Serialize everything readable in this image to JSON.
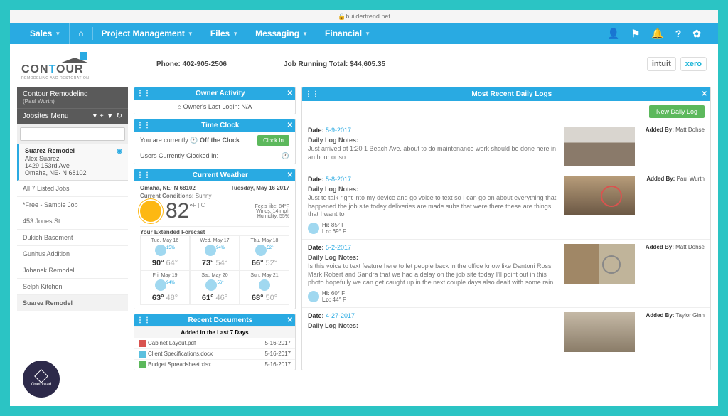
{
  "topbar": {
    "url": "buildertrend.net"
  },
  "menubar": {
    "items": [
      "Sales",
      "",
      "Project Management",
      "Files",
      "Messaging",
      "Financial"
    ],
    "icons": [
      "user-icon",
      "flag-icon",
      "bell-icon",
      "question-icon",
      "gear-icon"
    ]
  },
  "logo": {
    "brand": "CONTOUR",
    "sub": "REMODELING AND RESTORATION"
  },
  "header": {
    "phone_label": "Phone:",
    "phone": "402-905-2506",
    "total_label": "Job Running Total:",
    "total": "$44,605.35",
    "badge_intuit": "intuit",
    "badge_xero": "xero"
  },
  "sidebar": {
    "company": "Contour Remodeling",
    "company_sub": "(Paul Wurth)",
    "jobsites_label": "Jobsites Menu",
    "search_placeholder": "",
    "current": {
      "title": "Suarez Remodel",
      "sub1": "Alex Suarez",
      "sub2": "1429 153rd Ave",
      "sub3": "Omaha, NE· N 68102"
    },
    "filter": "All 7 Listed Jobs",
    "jobs": [
      "*Free - Sample Job",
      "453 Jones St",
      "Dukich Basement",
      "Gunhus Addition",
      "Johanek Remodel",
      "Selph Kitchen",
      "Suarez Remodel"
    ]
  },
  "panels": {
    "owner": {
      "title": "Owner Activity",
      "line": "Owner's Last Login: N/A"
    },
    "timeclock": {
      "title": "Time Clock",
      "status_pre": "You are currently",
      "status": "Off the Clock",
      "btn": "Clock In",
      "users_label": "Users Currently Clocked In:"
    },
    "weather": {
      "title": "Current Weather",
      "loc": "Omaha, NE· N 68102",
      "date": "Tuesday, May 16 2017",
      "cond_label": "Current Conditions:",
      "cond": "Sunny",
      "temp": "82",
      "feels_label": "Feels like:",
      "feels": "84°F",
      "wind_label": "Winds:",
      "wind": "14 mph",
      "hum_label": "Humidity:",
      "hum": "55%",
      "ext_title": "Your Extended Forecast",
      "forecast": [
        {
          "day": "Tue, May 16",
          "pct": "15%",
          "hi": "90°",
          "lo": "64°"
        },
        {
          "day": "Wed, May 17",
          "pct": "94%",
          "hi": "73°",
          "lo": "54°"
        },
        {
          "day": "Thu, May 18",
          "pct": "52°",
          "hi": "66°",
          "lo": "52°"
        },
        {
          "day": "Fri, May 19",
          "pct": "94%",
          "hi": "63°",
          "lo": "48°"
        },
        {
          "day": "Sat, May 20",
          "pct": "56°",
          "hi": "61°",
          "lo": "46°"
        },
        {
          "day": "Sun, May 21",
          "pct": "",
          "hi": "68°",
          "lo": "50°"
        }
      ]
    },
    "docs": {
      "title": "Recent Documents",
      "sub": "Added in the Last 7 Days",
      "items": [
        {
          "name": "Cabinet Layout.pdf",
          "date": "5-16-2017",
          "type": "pdf"
        },
        {
          "name": "Client Specifications.docx",
          "date": "5-16-2017",
          "type": "doc"
        },
        {
          "name": "Budget Spreadsheet.xlsx",
          "date": "5-16-2017",
          "type": "xls"
        }
      ]
    },
    "logs": {
      "title": "Most Recent Daily Logs",
      "new_btn": "New Daily Log",
      "date_label": "Date:",
      "notes_label": "Daily Log Notes:",
      "added_label": "Added By:",
      "hi_label": "Hi:",
      "lo_label": "Lo:",
      "items": [
        {
          "date": "5-9-2017",
          "notes": "Just arrived at 1:20 1 Beach Ave. about to do maintenance work should be done here in an hour or so",
          "author": "Matt Dohse",
          "hi": "",
          "lo": ""
        },
        {
          "date": "5-8-2017",
          "notes": "Just to talk right into my device and go voice to text so I can go on about everything that happened the job site today deliveries are made subs that were there these are things that I want to",
          "author": "Paul Wurth",
          "hi": "85° F",
          "lo": "69° F"
        },
        {
          "date": "5-2-2017",
          "notes": "Is this voice to text feature here to let people back in the office know like Dantoni Ross Mark Robert and Sandra that we had a delay on the job site today I'll point out in this photo hopefully we can get caught up in the next couple days also dealt with some rain",
          "author": "Matt Dohse",
          "hi": "60° F",
          "lo": "44° F"
        },
        {
          "date": "4-27-2017",
          "notes": "",
          "author": "Taylor Ginn",
          "hi": "",
          "lo": ""
        }
      ]
    }
  },
  "onethread": "Onethread"
}
